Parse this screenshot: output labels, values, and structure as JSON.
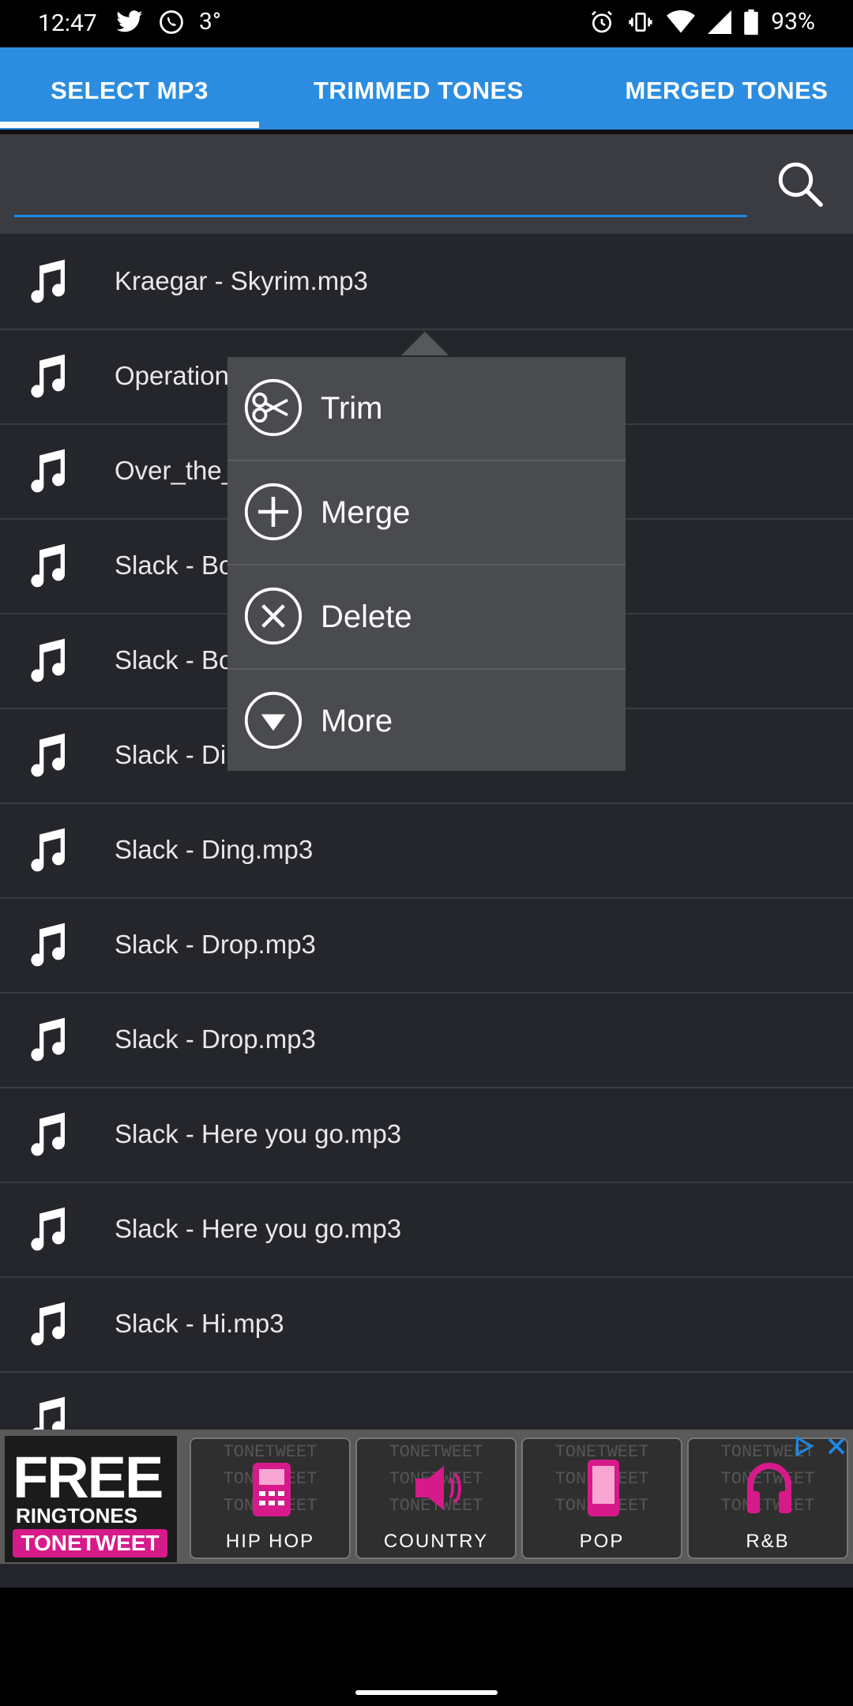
{
  "status": {
    "time": "12:47",
    "temp": "3°",
    "battery": "93%"
  },
  "tabs": [
    {
      "label": "SELECT MP3"
    },
    {
      "label": "TRIMMED TONES"
    },
    {
      "label": "MERGED TONES"
    }
  ],
  "search": {
    "value": "",
    "placeholder": ""
  },
  "files": [
    {
      "name": "Kraegar - Skyrim.mp3"
    },
    {
      "name": "Operation_11hz_20kb_mon"
    },
    {
      "name": "Over_the_"
    },
    {
      "name": "Slack - Bo"
    },
    {
      "name": "Slack - Bo"
    },
    {
      "name": "Slack - Ding"
    },
    {
      "name": "Slack - Ding.mp3"
    },
    {
      "name": "Slack - Drop.mp3"
    },
    {
      "name": "Slack - Drop.mp3"
    },
    {
      "name": "Slack - Here you go.mp3"
    },
    {
      "name": "Slack - Here you go.mp3"
    },
    {
      "name": "Slack - Hi.mp3"
    }
  ],
  "popup": {
    "items": [
      {
        "label": "Trim",
        "icon": "scissors-icon"
      },
      {
        "label": "Merge",
        "icon": "plus-icon"
      },
      {
        "label": "Delete",
        "icon": "x-icon"
      },
      {
        "label": "More",
        "icon": "down-triangle-icon"
      }
    ]
  },
  "ad": {
    "free": "FREE",
    "ringtones": "RINGTONES",
    "brand": "TONETWEET",
    "genres": [
      "HIP HOP",
      "COUNTRY",
      "POP",
      "R&B"
    ],
    "accent": "#d61a8a"
  },
  "colors": {
    "tab_bar": "#2c8de0",
    "list_bg": "#24262b",
    "popup_bg": "#4a4b4f"
  }
}
